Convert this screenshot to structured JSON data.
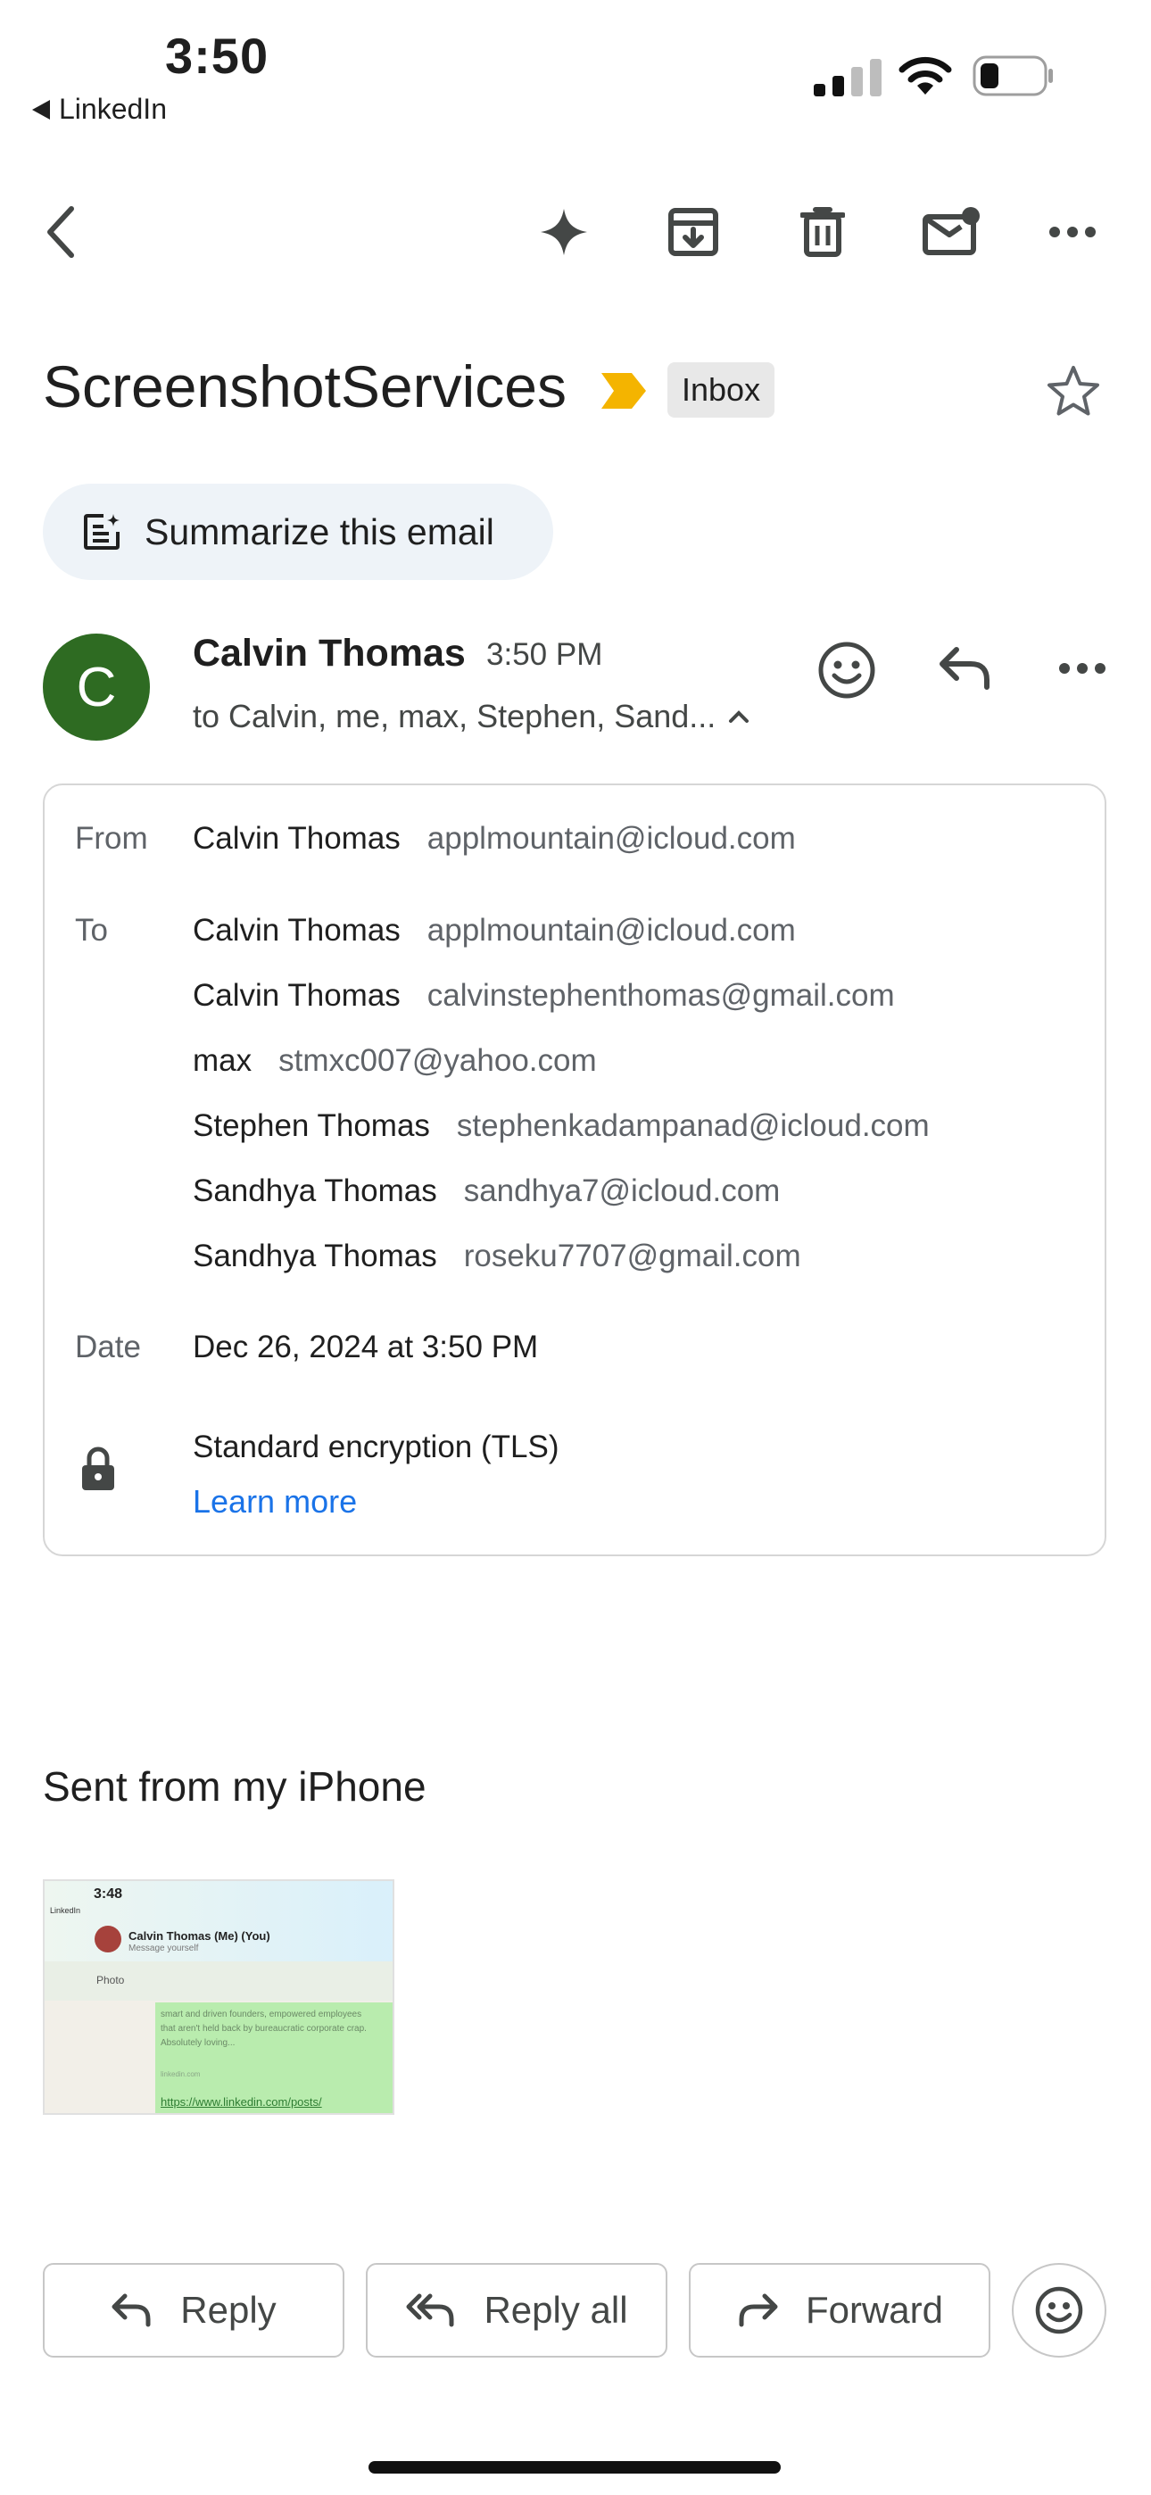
{
  "status_bar": {
    "time": "3:50",
    "back_app": "LinkedIn"
  },
  "email": {
    "subject": "ScreenshotServices",
    "label": "Inbox",
    "summarize": "Summarize this email",
    "sender": {
      "initial": "C",
      "name": "Calvin Thomas",
      "time": "3:50 PM",
      "to_summary": "to Calvin, me, max, Stephen, Sand..."
    },
    "details": {
      "from_label": "From",
      "from": {
        "name": "Calvin Thomas",
        "email": "applmountain@icloud.com"
      },
      "to_label": "To",
      "to": [
        {
          "name": "Calvin Thomas",
          "email": "applmountain@icloud.com"
        },
        {
          "name": "Calvin Thomas",
          "email": "calvinstephenthomas@gmail.com"
        },
        {
          "name": "max",
          "email": "stmxc007@yahoo.com"
        },
        {
          "name": "Stephen Thomas",
          "email": "stephenkadampanad@icloud.com"
        },
        {
          "name": "Sandhya Thomas",
          "email": "sandhya7@icloud.com"
        },
        {
          "name": "Sandhya Thomas",
          "email": "roseku7707@gmail.com"
        }
      ],
      "date_label": "Date",
      "date": "Dec 26, 2024 at 3:50 PM",
      "encryption": "Standard encryption (TLS)",
      "learn_more": "Learn more"
    },
    "body": "Sent from my iPhone",
    "attachment_preview": {
      "time": "3:48",
      "app": "LinkedIn",
      "contact": "Calvin Thomas (Me) (You)",
      "subtitle": "Message yourself",
      "photo": "Photo",
      "text": "smart and driven founders, empowered employees that aren't held back by bureaucratic corporate crap. Absolutely loving...",
      "source": "linkedin.com",
      "link": "https://www.linkedin.com/posts/"
    }
  },
  "actions": {
    "reply": "Reply",
    "reply_all": "Reply all",
    "forward": "Forward"
  },
  "colors": {
    "avatar": "#2e6b22",
    "label_marker": "#f4b400",
    "link": "#1a73e8"
  }
}
